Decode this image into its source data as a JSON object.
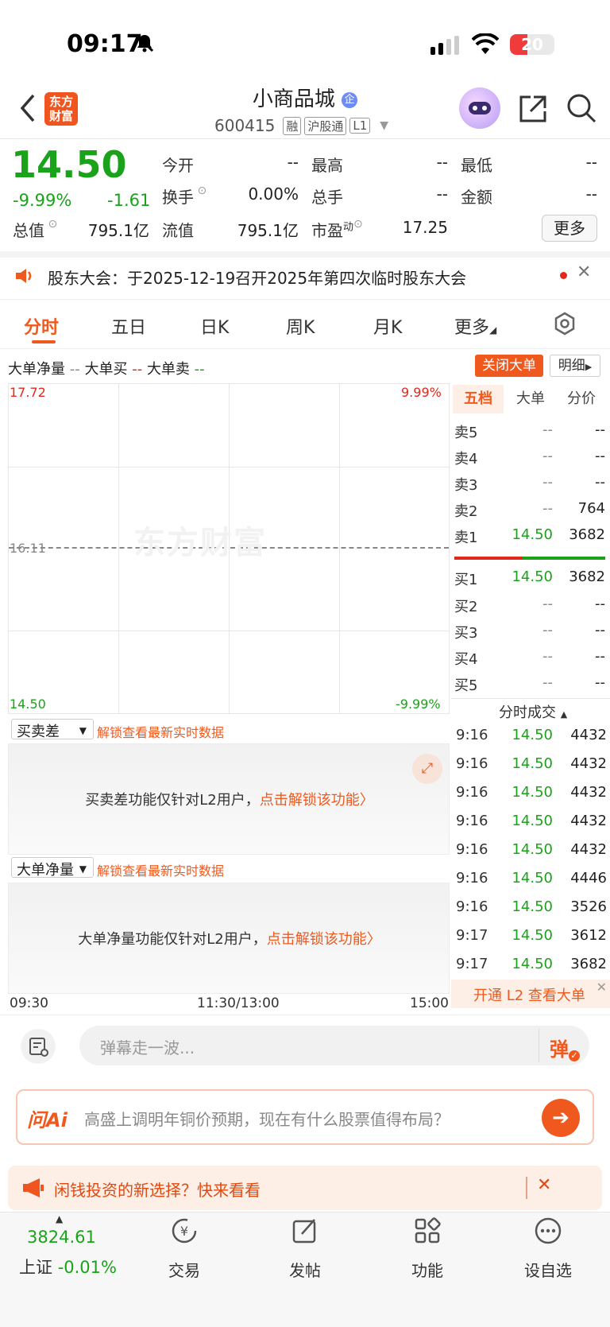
{
  "status": {
    "time": "09:17",
    "battery": "20"
  },
  "header": {
    "logo": [
      "东方",
      "财富"
    ],
    "name": "小商品城",
    "name_badge": "企",
    "code": "600415",
    "tags": [
      "融",
      "沪股通",
      "L1"
    ]
  },
  "quote": {
    "price": "14.50",
    "change_pct": "-9.99%",
    "change": "-1.61",
    "open_label": "今开",
    "open": "--",
    "high_label": "最高",
    "high": "--",
    "low_label": "最低",
    "low": "--",
    "turnover_label": "换手",
    "turnover": "0.00%",
    "vol_label": "总手",
    "vol": "--",
    "amount_label": "金额",
    "amount": "--",
    "mktcap_label": "总值",
    "mktcap": "795.1亿",
    "float_label": "流值",
    "float": "795.1亿",
    "pe_label": "市盈",
    "pe_sup": "动",
    "pe": "17.25",
    "more": "更多"
  },
  "notice": {
    "text": "股东大会：于2025-12-19召开2025年第四次临时股东大会"
  },
  "tabs": [
    "分时",
    "五日",
    "日K",
    "周K",
    "月K",
    "更多"
  ],
  "bigorder": {
    "net_label": "大单净量",
    "net": "--",
    "buy_label": "大单买",
    "buy": "--",
    "sell_label": "大单卖",
    "sell": "--",
    "close_btn": "关闭大单",
    "detail_btn": "明细"
  },
  "chart": {
    "top_price": "17.72",
    "top_pct": "9.99%",
    "mid_price": "16.11",
    "bottom_price": "14.50",
    "bottom_pct": "-9.99%",
    "watermark": "东方财富",
    "times": [
      "09:30",
      "11:30/13:00",
      "15:00"
    ]
  },
  "orderbook": {
    "tabs": [
      "五档",
      "大单",
      "分价"
    ],
    "asks": [
      {
        "label": "卖5",
        "price": "--",
        "vol": "--"
      },
      {
        "label": "卖4",
        "price": "--",
        "vol": "--"
      },
      {
        "label": "卖3",
        "price": "--",
        "vol": "--"
      },
      {
        "label": "卖2",
        "price": "--",
        "vol": "764"
      },
      {
        "label": "卖1",
        "price": "14.50",
        "vol": "3682"
      }
    ],
    "bids": [
      {
        "label": "买1",
        "price": "14.50",
        "vol": "3682"
      },
      {
        "label": "买2",
        "price": "--",
        "vol": "--"
      },
      {
        "label": "买3",
        "price": "--",
        "vol": "--"
      },
      {
        "label": "买4",
        "price": "--",
        "vol": "--"
      },
      {
        "label": "买5",
        "price": "--",
        "vol": "--"
      }
    ]
  },
  "ticks": {
    "title": "分时成交",
    "rows": [
      {
        "time": "9:16",
        "price": "14.50",
        "vol": "4432"
      },
      {
        "time": "9:16",
        "price": "14.50",
        "vol": "4432"
      },
      {
        "time": "9:16",
        "price": "14.50",
        "vol": "4432"
      },
      {
        "time": "9:16",
        "price": "14.50",
        "vol": "4432"
      },
      {
        "time": "9:16",
        "price": "14.50",
        "vol": "4432"
      },
      {
        "time": "9:16",
        "price": "14.50",
        "vol": "4446"
      },
      {
        "time": "9:16",
        "price": "14.50",
        "vol": "3526"
      },
      {
        "time": "9:17",
        "price": "14.50",
        "vol": "3612"
      },
      {
        "time": "9:17",
        "price": "14.50",
        "vol": "3682"
      }
    ],
    "l2_link": "开通 L2 查看大单"
  },
  "panels": {
    "spread_label": "买卖差",
    "net_label": "大单净量",
    "unlock_hint": "解锁查看最新实时数据",
    "spread_msg": "买卖差功能仅针对L2用户，",
    "net_msg": "大单净量功能仅针对L2用户，",
    "unlock_link": "点击解锁该功能"
  },
  "comment": {
    "placeholder": "弹幕走一波...",
    "danmu": "弹"
  },
  "ai": {
    "logo": "问Ai",
    "prompt": "高盛上调明年铜价预期，现在有什么股票值得布局？"
  },
  "promo": {
    "text": "闲钱投资的新选择？快来看看"
  },
  "bottom": {
    "index_value": "3824.61",
    "index_name": "上证",
    "index_change": "-0.01%",
    "items": [
      "交易",
      "发帖",
      "功能",
      "设自选"
    ]
  },
  "colors": {
    "up": "#e0281c",
    "down": "#1aa31a",
    "accent": "#f0591d"
  }
}
